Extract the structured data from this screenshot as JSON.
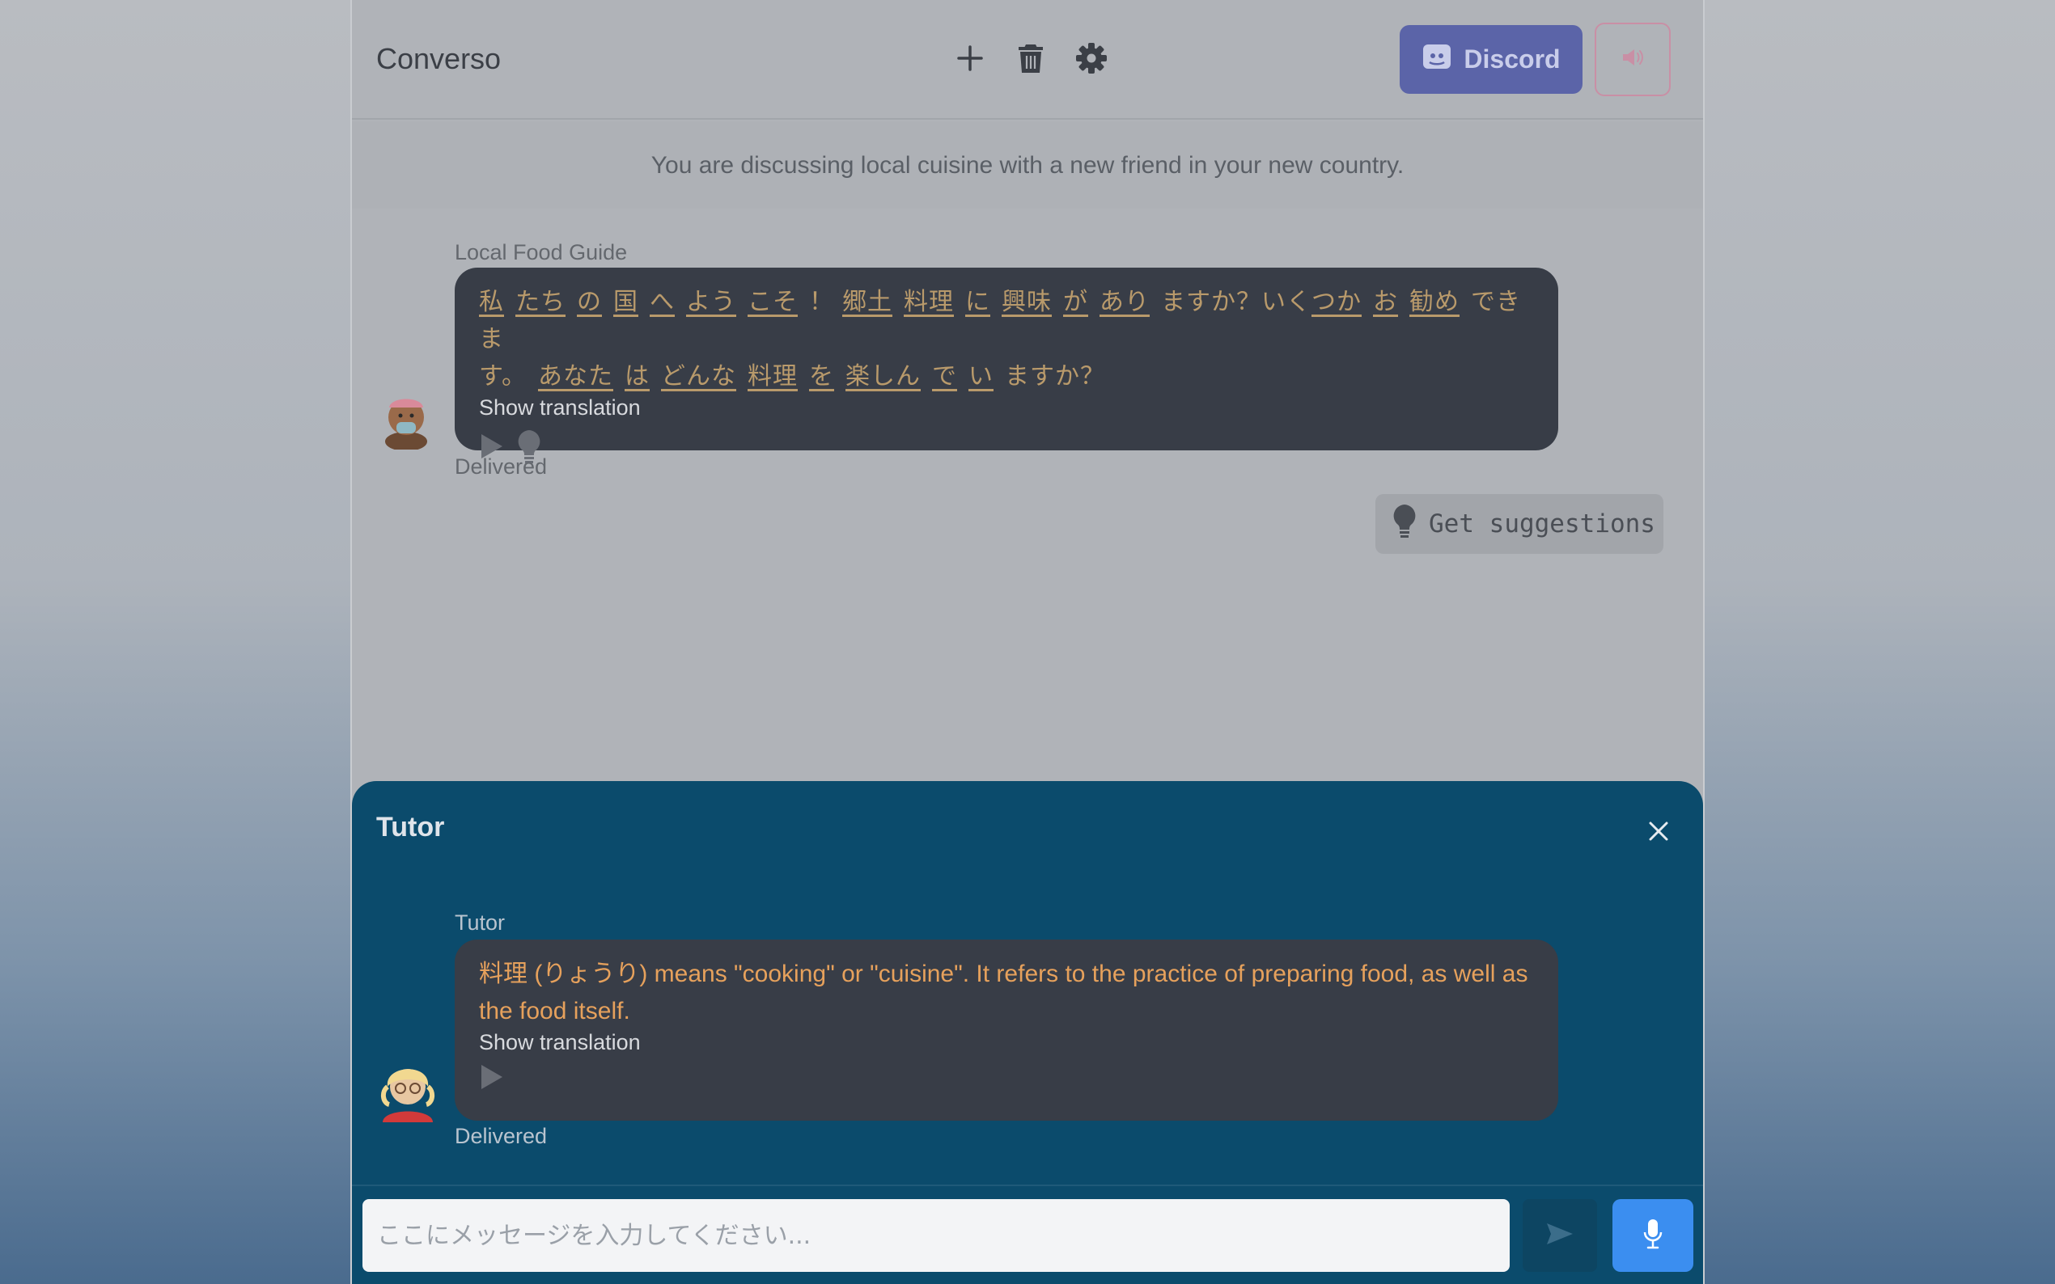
{
  "header": {
    "app_title": "Converso",
    "discord_label": "Discord"
  },
  "scenario": "You are discussing local cuisine with a new friend in your new country.",
  "chat": {
    "guide_name": "Local Food Guide",
    "guide_line1_words": [
      "私",
      "たち",
      "の",
      "国",
      "へ",
      "よう",
      "こそ",
      "！",
      "郷土",
      "料理",
      "に",
      "興味",
      "が",
      "あり",
      "ますか？いく",
      "つか",
      "お",
      "勧め",
      "できま"
    ],
    "guide_line2_words": [
      "す。",
      "あなた",
      "は",
      "どんな",
      "料理",
      "を",
      "楽しん",
      "で",
      "い",
      "ますか？"
    ],
    "show_translation": "Show translation",
    "delivered": "Delivered",
    "suggestions_label": "Get suggestions"
  },
  "tutor": {
    "panel_title": "Tutor",
    "sender": "Tutor",
    "message": "料理 (りょうり) means \"cooking\" or \"cuisine\". It refers to the practice of preparing food, as well as the food itself.",
    "show_translation": "Show translation",
    "delivered": "Delivered"
  },
  "composer": {
    "placeholder": "ここにメッセージを入力してください..."
  },
  "colors": {
    "discord": "#5b64a8",
    "tutor_panel": "#0b4b6c",
    "bubble": "#383d47",
    "mic": "#3b8ef0"
  }
}
